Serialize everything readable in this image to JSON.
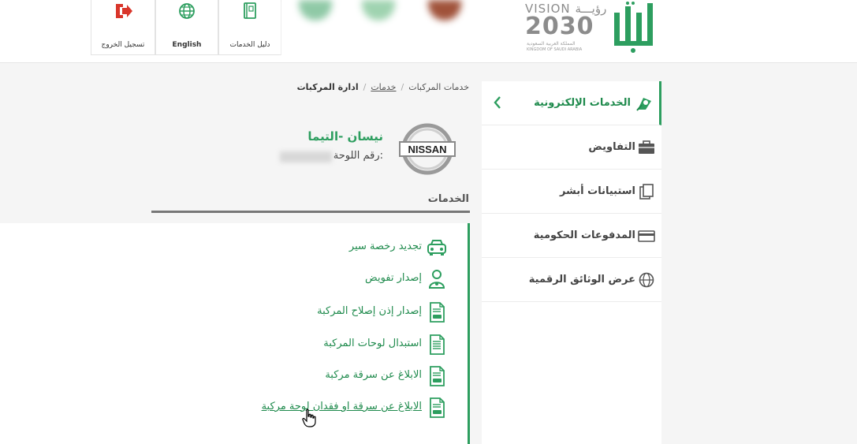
{
  "header": {
    "vision_top": "VISION رؤيـــة",
    "vision_year": "2030",
    "vision_sub_ar": "المملكة العربية السعودية",
    "vision_sub_en": "KINGDOM OF SAUDI ARABIA",
    "buttons": [
      {
        "label": "تسجيل الخروج",
        "icon": "logout-icon"
      },
      {
        "label": "English",
        "icon": "globe-icon"
      },
      {
        "label": "دليل الخدمات",
        "icon": "book-icon"
      }
    ]
  },
  "sidebar": {
    "items": [
      {
        "label": "الخدمات الإلكترونية",
        "icon": "e-services-icon",
        "active": true
      },
      {
        "label": "التفاويض",
        "icon": "briefcase-icon"
      },
      {
        "label": "استبيانات أبشر",
        "icon": "survey-icon"
      },
      {
        "label": "المدفوعات الحكومية",
        "icon": "card-icon"
      },
      {
        "label": "عرض الوثائق الرقمية",
        "icon": "globe-icon"
      }
    ]
  },
  "breadcrumb": {
    "items": [
      "خدمات المركبات",
      "خدمات",
      "ادارة المركبات"
    ]
  },
  "vehicle": {
    "brand_text": "NISSAN",
    "name": "نيسان -التيما",
    "plate_label": "رقم اللوحة:"
  },
  "services": {
    "title": "الخدمات",
    "items": [
      {
        "label": "تجديد رخصة سير",
        "icon": "car-icon"
      },
      {
        "label": "إصدار تفويض",
        "icon": "person-icon"
      },
      {
        "label": "إصدار إذن إصلاح المركبة",
        "icon": "document-icon"
      },
      {
        "label": "استبدال لوحات المركبة",
        "icon": "document-icon"
      },
      {
        "label": "الابلاغ عن سرقة مركبة",
        "icon": "document-icon"
      },
      {
        "label": "الابلاغ عن سرقة او فقدان لوحة مركبة",
        "icon": "document-icon"
      }
    ]
  },
  "colors": {
    "accent": "#2d9e5f",
    "logout_red": "#d9362b"
  }
}
